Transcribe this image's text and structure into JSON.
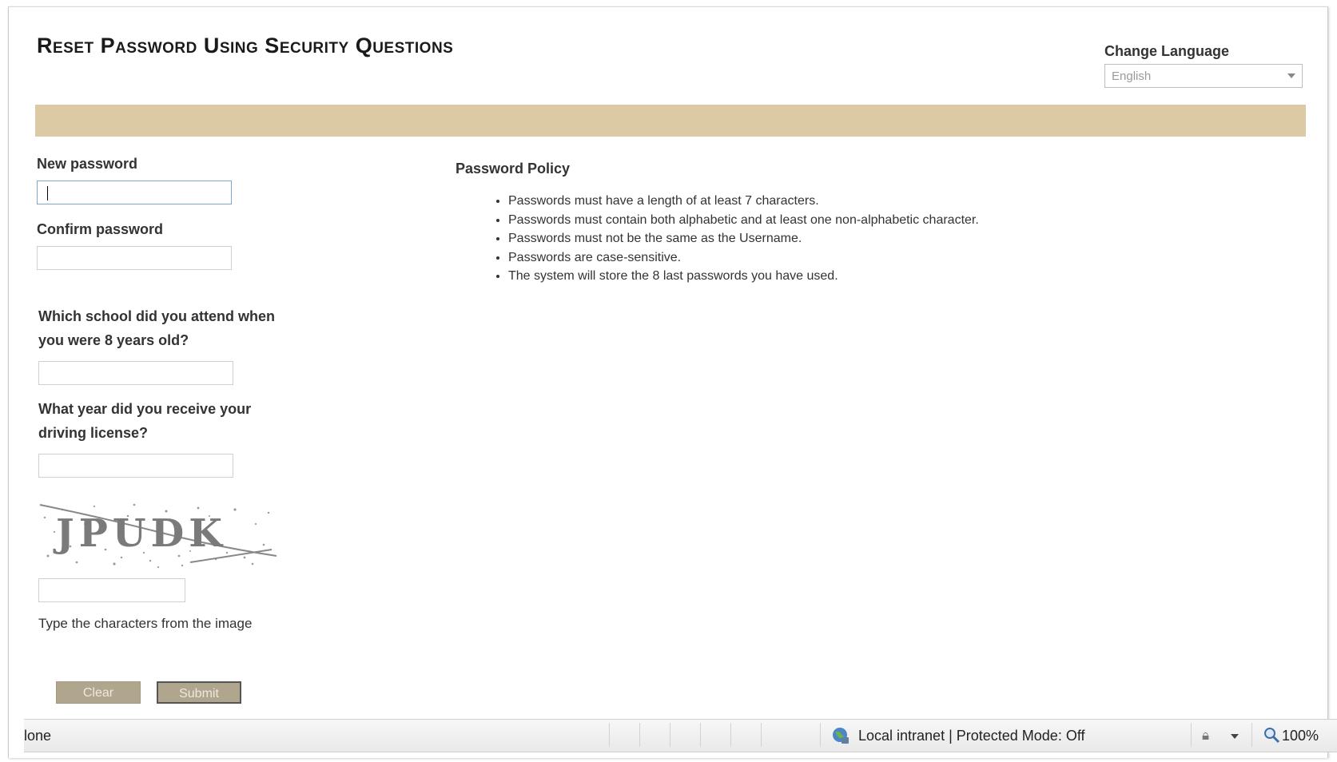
{
  "page": {
    "title": "Reset Password Using Security Questions"
  },
  "language": {
    "label": "Change Language",
    "selected": "English"
  },
  "form": {
    "new_password_label": "New password",
    "new_password_value": "",
    "confirm_password_label": "Confirm password",
    "confirm_password_value": "",
    "question1_line1": "Which school did you attend when",
    "question1_line2": "you were 8 years old?",
    "answer1_value": "",
    "question2_line1": "What year did you receive your",
    "question2_line2": "driving license?",
    "answer2_value": "",
    "captcha_text": "JPUDK",
    "captcha_value": "",
    "captcha_hint": "Type the characters from the image",
    "clear_label": "Clear",
    "submit_label": "Submit"
  },
  "policy": {
    "title": "Password Policy",
    "items": [
      "Passwords must have a length of at least 7 characters.",
      "Passwords must contain both alphabetic and at least one non-alphabetic character.",
      "Passwords must not be the same as the Username.",
      "Passwords are case-sensitive.",
      "The system will store the 8 last passwords you have used."
    ]
  },
  "statusbar": {
    "status": "lone",
    "zone": "Local intranet | Protected Mode: Off",
    "zoom": "100%"
  },
  "colors": {
    "banner": "#dccaa4",
    "button_bg": "#b0a58d",
    "button_text": "#efe9dc"
  },
  "icons": {
    "zone": "globe-icon",
    "protected": "lock-icon",
    "zoom": "magnifier-icon"
  }
}
